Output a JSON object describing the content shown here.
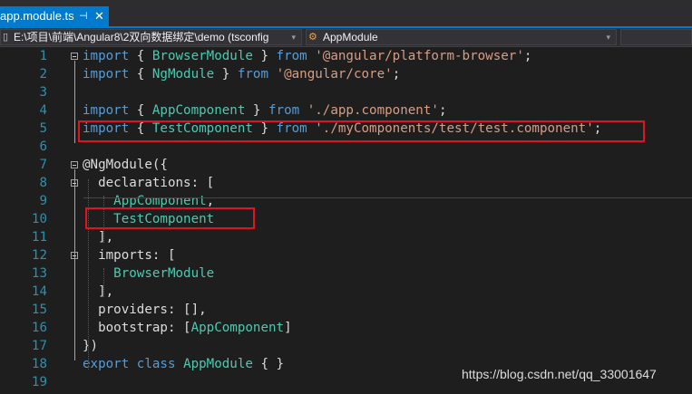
{
  "tab": {
    "filename": "app.module.ts",
    "pin": "⊹",
    "close": "✕"
  },
  "navbar": {
    "project": "E:\\项目\\前端\\Angular8\\2双向数据绑定\\demo (tsconfig",
    "scope": "AppModule",
    "arrow": "▾"
  },
  "code": {
    "lines": [
      {
        "n": "1",
        "t": [
          [
            "kw",
            "import"
          ],
          [
            "p",
            " { "
          ],
          [
            "cls",
            "BrowserModule"
          ],
          [
            "p",
            " } "
          ],
          [
            "kw",
            "from"
          ],
          [
            "p",
            " "
          ],
          [
            "str",
            "'@angular/platform-browser'"
          ],
          [
            "p",
            ";"
          ]
        ]
      },
      {
        "n": "2",
        "t": [
          [
            "kw",
            "import"
          ],
          [
            "p",
            " { "
          ],
          [
            "cls",
            "NgModule"
          ],
          [
            "p",
            " } "
          ],
          [
            "kw",
            "from"
          ],
          [
            "p",
            " "
          ],
          [
            "str",
            "'@angular/core'"
          ],
          [
            "p",
            ";"
          ]
        ]
      },
      {
        "n": "3",
        "t": []
      },
      {
        "n": "4",
        "t": [
          [
            "kw",
            "import"
          ],
          [
            "p",
            " { "
          ],
          [
            "cls",
            "AppComponent"
          ],
          [
            "p",
            " } "
          ],
          [
            "kw",
            "from"
          ],
          [
            "p",
            " "
          ],
          [
            "str",
            "'./app.component'"
          ],
          [
            "p",
            ";"
          ]
        ]
      },
      {
        "n": "5",
        "t": [
          [
            "kw",
            "import"
          ],
          [
            "p",
            " { "
          ],
          [
            "cls",
            "TestComponent"
          ],
          [
            "p",
            " } "
          ],
          [
            "kw",
            "from"
          ],
          [
            "p",
            " "
          ],
          [
            "str",
            "'./myComponents/test/test.component'"
          ],
          [
            "p",
            ";"
          ]
        ]
      },
      {
        "n": "6",
        "t": []
      },
      {
        "n": "7",
        "t": [
          [
            "p",
            "@NgModule({"
          ]
        ]
      },
      {
        "n": "8",
        "t": [
          [
            "p",
            "  declarations: ["
          ]
        ]
      },
      {
        "n": "9",
        "t": [
          [
            "p",
            "    "
          ],
          [
            "cls",
            "AppComponent"
          ],
          [
            "p",
            ","
          ]
        ]
      },
      {
        "n": "10",
        "t": [
          [
            "p",
            "    "
          ],
          [
            "cls",
            "TestComponent"
          ]
        ]
      },
      {
        "n": "11",
        "t": [
          [
            "p",
            "  ],"
          ]
        ]
      },
      {
        "n": "12",
        "t": [
          [
            "p",
            "  imports: ["
          ]
        ]
      },
      {
        "n": "13",
        "t": [
          [
            "p",
            "    "
          ],
          [
            "cls",
            "BrowserModule"
          ]
        ]
      },
      {
        "n": "14",
        "t": [
          [
            "p",
            "  ],"
          ]
        ]
      },
      {
        "n": "15",
        "t": [
          [
            "p",
            "  providers: [],"
          ]
        ]
      },
      {
        "n": "16",
        "t": [
          [
            "p",
            "  bootstrap: ["
          ],
          [
            "cls",
            "AppComponent"
          ],
          [
            "p",
            "]"
          ]
        ]
      },
      {
        "n": "17",
        "t": [
          [
            "p",
            "})"
          ]
        ]
      },
      {
        "n": "18",
        "t": [
          [
            "kw",
            "export"
          ],
          [
            "p",
            " "
          ],
          [
            "kw",
            "class"
          ],
          [
            "p",
            " "
          ],
          [
            "cls",
            "AppModule"
          ],
          [
            "p",
            " { }"
          ]
        ]
      },
      {
        "n": "19",
        "t": []
      }
    ]
  },
  "watermark": "https://blog.csdn.net/qq_33001647",
  "icons": {
    "file": "file-icon",
    "class": "class-icon"
  }
}
